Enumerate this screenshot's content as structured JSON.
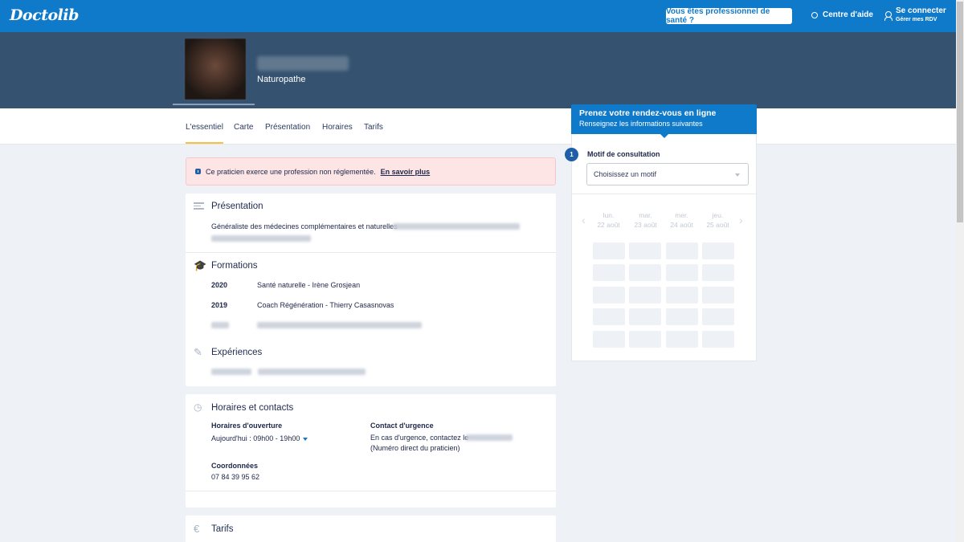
{
  "header": {
    "logo": "Doctolib",
    "pro_button": "Vous êtes professionnel de santé ?",
    "help": "Centre d'aide",
    "login": "Se connecter",
    "login_sub": "Gérer mes RDV"
  },
  "profile": {
    "specialty": "Naturopathe"
  },
  "tabs": [
    "L'essentiel",
    "Carte",
    "Présentation",
    "Horaires",
    "Tarifs"
  ],
  "alert": {
    "text": "Ce praticien exerce une profession non réglementée.",
    "link": "En savoir plus"
  },
  "presentation": {
    "title": "Présentation",
    "text": "Généraliste des médecines complémentaires et naturelles"
  },
  "formations": {
    "title": "Formations",
    "items": [
      {
        "year": "2020",
        "label": "Santé naturelle - Irène Grosjean"
      },
      {
        "year": "2019",
        "label": "Coach Régénération - Thierry Casasnovas"
      }
    ]
  },
  "experiences": {
    "title": "Expériences"
  },
  "horaires": {
    "title": "Horaires et contacts",
    "opening_label": "Horaires d'ouverture",
    "today": "Aujourd'hui :",
    "hours": "09h00 - 19h00",
    "emergency_label": "Contact d'urgence",
    "emergency_text": "En cas d'urgence, contactez le",
    "emergency_note": "(Numéro direct du praticien)",
    "coords_label": "Coordonnées",
    "phone": "07 84 39 95 62"
  },
  "tarifs": {
    "title": "Tarifs"
  },
  "booking": {
    "title": "Prenez votre rendez-vous en ligne",
    "subtitle": "Renseignez les informations suivantes",
    "step": "1",
    "motif_label": "Motif de consultation",
    "select_placeholder": "Choisissez un motif",
    "days": [
      {
        "name": "lun.",
        "date": "22 août"
      },
      {
        "name": "mar.",
        "date": "23 août"
      },
      {
        "name": "mer.",
        "date": "24 août"
      },
      {
        "name": "jeu.",
        "date": "25 août"
      }
    ]
  },
  "colors": {
    "primary": "#107aca",
    "band": "#355270",
    "alert_bg": "#fde5e6",
    "tab_underline": "#f7c042"
  }
}
